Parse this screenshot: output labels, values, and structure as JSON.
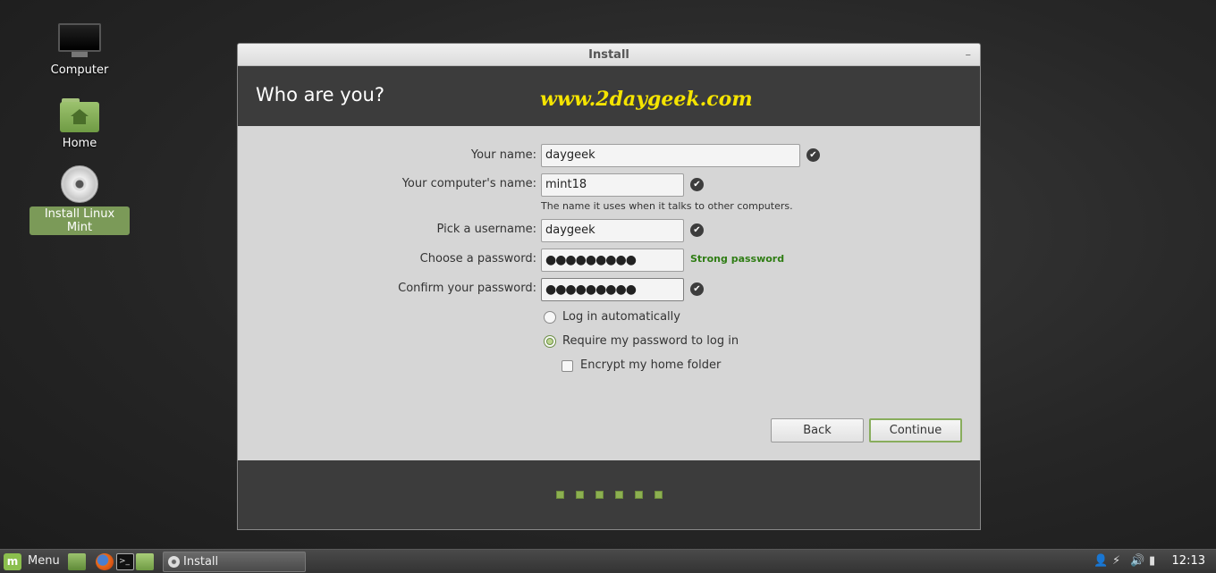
{
  "desktop": {
    "icons": [
      {
        "label": "Computer"
      },
      {
        "label": "Home"
      },
      {
        "label": "Install Linux Mint"
      }
    ]
  },
  "window": {
    "title": "Install",
    "minimize_glyph": "–",
    "heading": "Who are you?",
    "watermark": "www.2daygeek.com"
  },
  "form": {
    "name_label": "Your name:",
    "name_value": "daygeek",
    "computer_label": "Your computer's name:",
    "computer_value": "mint18",
    "computer_hint": "The name it uses when it talks to other computers.",
    "username_label": "Pick a username:",
    "username_value": "daygeek",
    "password_label": "Choose a password:",
    "password_value": "●●●●●●●●●",
    "password_strength": "Strong password",
    "confirm_label": "Confirm your password:",
    "confirm_value": "●●●●●●●●●",
    "login_auto_label": "Log in automatically",
    "login_password_label": "Require my password to log in",
    "encrypt_label": "Encrypt my home folder",
    "selected_login_option": "require_password",
    "encrypt_checked": false
  },
  "buttons": {
    "back": "Back",
    "continue": "Continue"
  },
  "progress": {
    "steps_total": 6,
    "steps_shown": 6
  },
  "taskbar": {
    "menu_label": "Menu",
    "task_label": "Install",
    "clock": "12:13"
  },
  "colors": {
    "accent_green": "#8cb050",
    "strong_password": "#2f7d14",
    "watermark": "#f5e400"
  }
}
